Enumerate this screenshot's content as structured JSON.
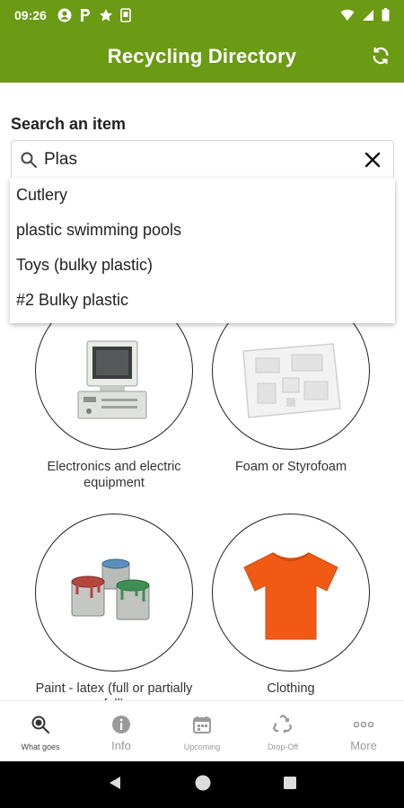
{
  "status_bar": {
    "time": "09:26"
  },
  "app_bar": {
    "title": "Recycling Directory"
  },
  "search": {
    "label": "Search an item",
    "value": "Plas"
  },
  "suggestions": [
    "Cutlery",
    "plastic swimming pools",
    "Toys (bulky plastic)",
    "#2 Bulky plastic"
  ],
  "categories": [
    {
      "label": "Electronics and electric equipment",
      "icon": "computer-icon"
    },
    {
      "label": "Foam or Styrofoam",
      "icon": "foam-icon"
    },
    {
      "label": "Paint - latex (full or partially full)",
      "icon": "paint-cans-icon"
    },
    {
      "label": "Clothing",
      "icon": "tshirt-icon"
    }
  ],
  "bottom_nav": [
    {
      "label": "What goes",
      "icon": "magnify-icon",
      "active": true
    },
    {
      "label": "Info",
      "icon": "info-icon"
    },
    {
      "label": "Upcoming",
      "icon": "calendar-icon"
    },
    {
      "label": "Drop-Off",
      "icon": "recycle-icon"
    },
    {
      "label": "More",
      "icon": "more-icon"
    }
  ],
  "colors": {
    "brand_green": "#6b9a14",
    "shirt_orange": "#f05a14"
  }
}
